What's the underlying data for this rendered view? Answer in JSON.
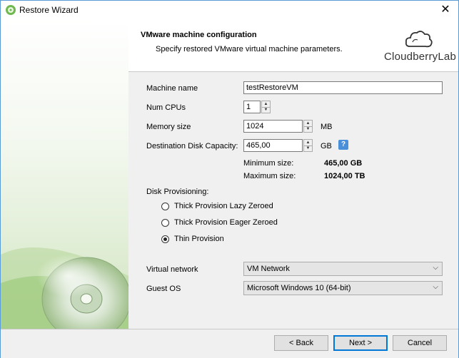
{
  "window": {
    "title": "Restore Wizard",
    "close_glyph": "✕"
  },
  "header": {
    "title": "VMware machine configuration",
    "subtitle": "Specify restored VMware virtual machine parameters.",
    "logo_text": "CloudberryLab"
  },
  "form": {
    "machine_name": {
      "label": "Machine name",
      "value": "testRestoreVM"
    },
    "num_cpus": {
      "label": "Num CPUs",
      "value": "1"
    },
    "memory": {
      "label": "Memory size",
      "value": "1024",
      "unit": "MB"
    },
    "disk": {
      "label": "Destination Disk Capacity:",
      "value": "465,00",
      "unit": "GB",
      "help": "?"
    },
    "min_size": {
      "label": "Minimum size:",
      "value": "465,00 GB"
    },
    "max_size": {
      "label": "Maximum size:",
      "value": "1024,00 TB"
    },
    "provisioning": {
      "label": "Disk Provisioning:",
      "options": [
        {
          "label": "Thick Provision Lazy Zeroed",
          "selected": false
        },
        {
          "label": "Thick Provision Eager Zeroed",
          "selected": false
        },
        {
          "label": "Thin Provision",
          "selected": true
        }
      ]
    },
    "network": {
      "label": "Virtual network",
      "value": "VM Network"
    },
    "guest_os": {
      "label": "Guest OS",
      "value": "Microsoft Windows 10 (64-bit)"
    }
  },
  "buttons": {
    "back": "< Back",
    "next": "Next >",
    "cancel": "Cancel"
  },
  "icons": {
    "spin_up": "▲",
    "spin_down": "▼",
    "combo_arrow": "⌵"
  },
  "colors": {
    "accent": "#0078d7",
    "help": "#4a90d9"
  }
}
